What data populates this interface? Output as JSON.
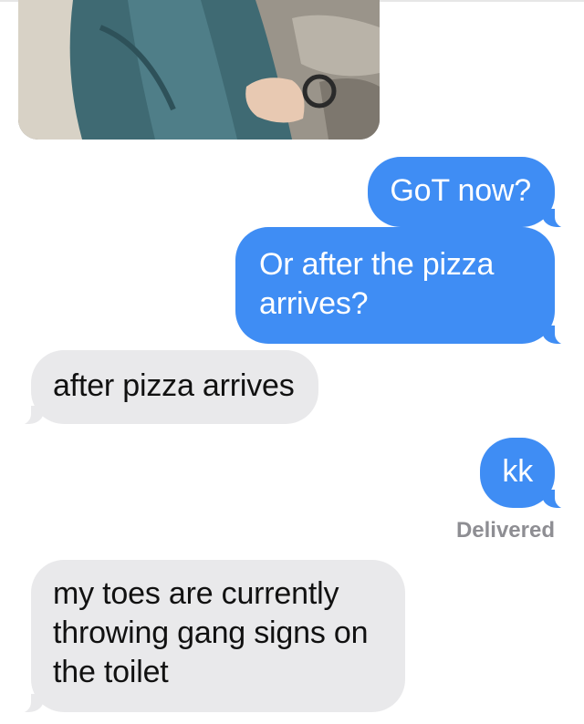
{
  "conversation": {
    "photo": {
      "icon": "photo-thumbnail"
    },
    "messages": [
      {
        "side": "outgoing",
        "text": "GoT now?"
      },
      {
        "side": "outgoing",
        "text": "Or after the pizza arrives?"
      },
      {
        "side": "incoming",
        "text": "after pizza arrives"
      },
      {
        "side": "outgoing",
        "text": "kk"
      },
      {
        "side": "incoming",
        "text": "my toes are currently throwing gang signs on the toilet"
      }
    ],
    "status": "Delivered",
    "colors": {
      "outgoing": "#3f8df4",
      "incoming": "#e9e9eb"
    }
  }
}
